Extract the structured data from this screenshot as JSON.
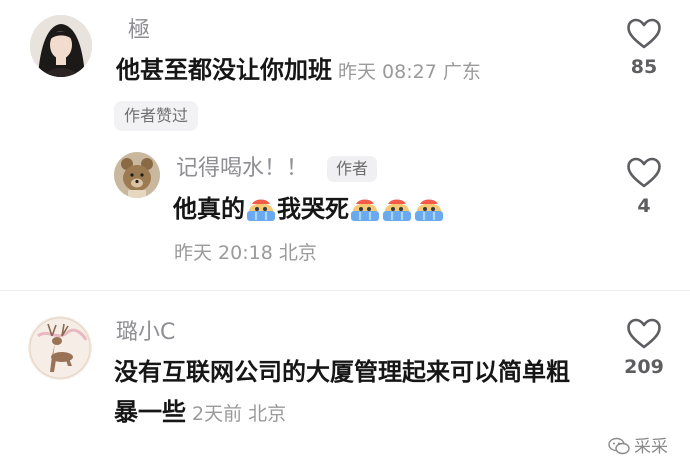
{
  "comments": [
    {
      "username": "極",
      "text": "他甚至都没让你加班",
      "time": "昨天 08:27",
      "location": "广东",
      "likes": "85",
      "badge": "作者赞过",
      "reply": {
        "username": "记得喝水！！",
        "author_tag": "作者",
        "text_part1": "他真的",
        "text_part2": "我哭死",
        "emoji": "crying-emoji",
        "time": "昨天 20:18",
        "location": "北京",
        "likes": "4"
      }
    },
    {
      "username": "璐小C",
      "text_line1": "没有互联网公司的大厦管理起来可以简单粗",
      "text_line2": "暴一些",
      "time": "2天前",
      "location": "北京",
      "likes": "209"
    }
  ],
  "watermark": "采采",
  "colors": {
    "name": "#8e8e93",
    "text": "#161616",
    "meta": "#9a9a9a",
    "heart": "#5d5d62"
  }
}
